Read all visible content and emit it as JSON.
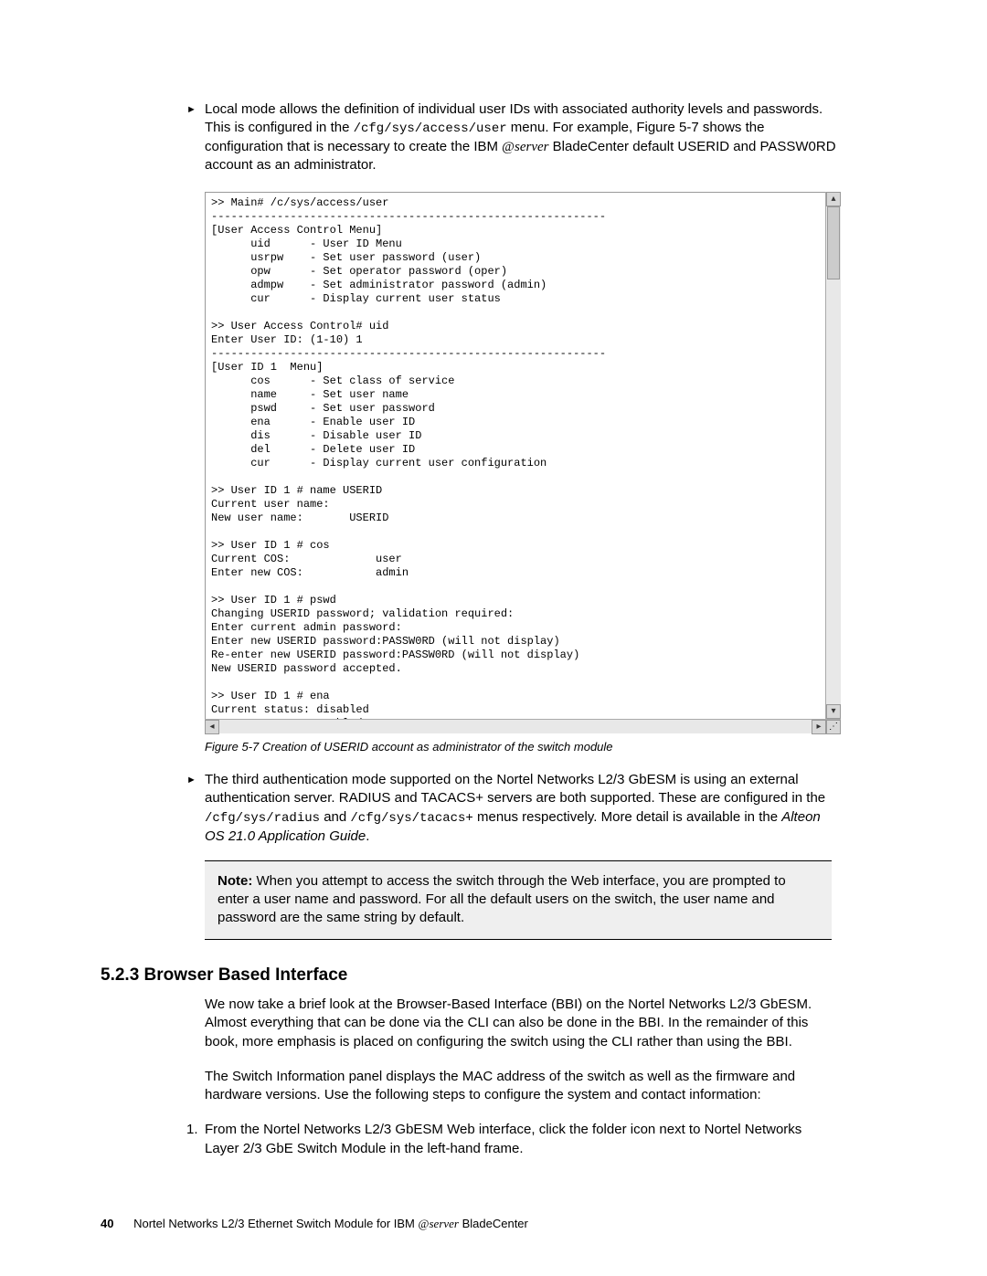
{
  "bullet1_text_a": "Local mode allows the definition of individual user IDs with associated authority levels and passwords. This is configured in the ",
  "bullet1_mono": "/cfg/sys/access/user",
  "bullet1_text_b": " menu. For example, Figure 5-7 shows the configuration that is necessary to create the IBM ",
  "bullet1_eserver": "server",
  "bullet1_text_c": " BladeCenter default USERID and PASSW0RD account as an administrator.",
  "terminal_text": ">> Main# /c/sys/access/user\n------------------------------------------------------------\n[User Access Control Menu]\n      uid      - User ID Menu\n      usrpw    - Set user password (user)\n      opw      - Set operator password (oper)\n      admpw    - Set administrator password (admin)\n      cur      - Display current user status\n\n>> User Access Control# uid\nEnter User ID: (1-10) 1\n------------------------------------------------------------\n[User ID 1  Menu]\n      cos      - Set class of service\n      name     - Set user name\n      pswd     - Set user password\n      ena      - Enable user ID\n      dis      - Disable user ID\n      del      - Delete user ID\n      cur      - Display current user configuration\n\n>> User ID 1 # name USERID\nCurrent user name:\nNew user name:       USERID\n\n>> User ID 1 # cos\nCurrent COS:             user\nEnter new COS:           admin\n\n>> User ID 1 # pswd\nChanging USERID password; validation required:\nEnter current admin password:\nEnter new USERID password:PASSW0RD (will not display)\nRe-enter new USERID password:PASSW0RD (will not display)\nNew USERID password accepted.\n\n>> User ID 1 # ena\nCurrent status: disabled\nNew status:     enabled",
  "caption_label": "Figure 5-7   Creation of USERID account as administrator of the switch module",
  "bullet2_text_a": "The third authentication mode supported on the Nortel Networks L2/3 GbESM is using an external authentication server. RADIUS and TACACS+ servers are both supported. These are configured in the ",
  "bullet2_mono_a": "/cfg/sys/radius",
  "bullet2_text_b": " and ",
  "bullet2_mono_b": "/cfg/sys/tacacs+",
  "bullet2_text_c": " menus respectively. More detail is available in the ",
  "bullet2_italic": "Alteon OS 21.0 Application Guide",
  "bullet2_text_d": ".",
  "note_label": "Note:",
  "note_body": " When you attempt to access the switch through the Web interface, you are prompted to enter a user name and password. For all the default users on the switch, the user name and password are the same string by default.",
  "section_num": "5.2.3",
  "section_title": "  Browser Based Interface",
  "para1": "We now take a brief look at the Browser-Based Interface (BBI) on the Nortel Networks L2/3 GbESM. Almost everything that can be done via the CLI can also be done in the BBI. In the remainder of this book, more emphasis is placed on configuring the switch using the CLI rather than using the BBI.",
  "para2": "The Switch Information panel displays the MAC address of the switch as well as the firmware and hardware versions. Use the following steps to configure the system and contact information:",
  "step1_num": "1.",
  "step1_text": "From the Nortel Networks L2/3 GbESM Web interface, click the folder icon next to Nortel Networks Layer 2/3 GbE Switch Module in the left-hand frame.",
  "page_number": "40",
  "footer_text_a": "Nortel Networks L2/3 Ethernet Switch Module for IBM ",
  "footer_eserver": "server",
  "footer_text_b": " BladeCenter"
}
